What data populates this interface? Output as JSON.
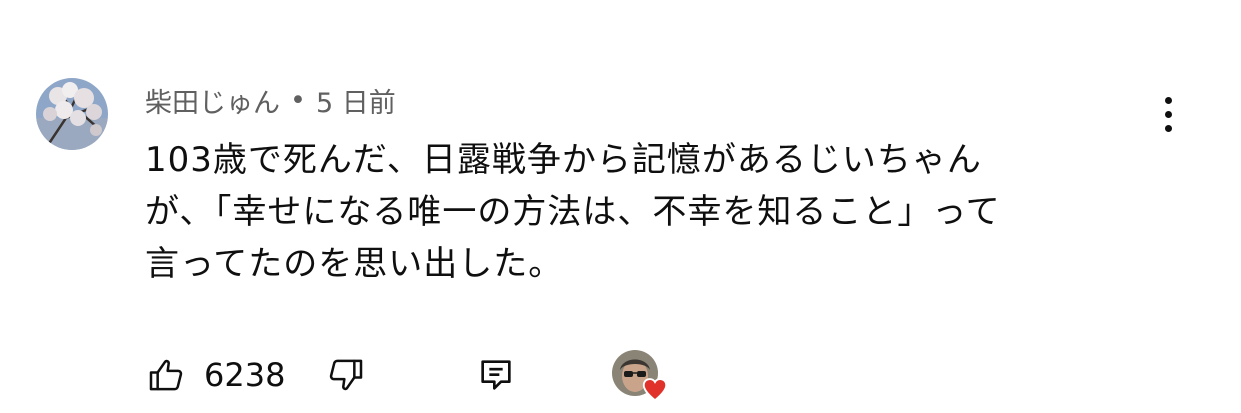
{
  "comment": {
    "author": "柴田じゅん",
    "separator": "•",
    "time": "5 日前",
    "text": "103歳で死んだ、日露戦争から記憶があるじいちゃん\nが、「幸せになる唯一の方法は、不幸を知ること」って\n言ってたのを思い出した。",
    "like_count": "6238",
    "icons": {
      "avatar": "cherry-blossom-avatar",
      "more": "more-vertical-icon",
      "like": "thumbs-up-icon",
      "dislike": "thumbs-down-icon",
      "reply": "reply-comment-icon",
      "creator": "creator-avatar",
      "heart": "heart-icon"
    },
    "colors": {
      "text": "#0f0f0f",
      "secondary": "#606060",
      "heart": "#e0322b"
    }
  }
}
